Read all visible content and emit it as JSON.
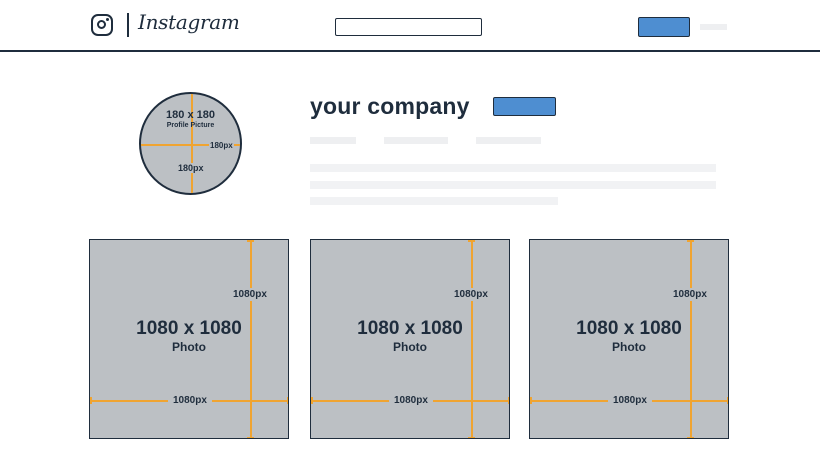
{
  "header": {
    "logo_icon": "instagram-camera-icon",
    "wordmark": "Instagram",
    "search": {
      "value": "",
      "placeholder": ""
    }
  },
  "profile": {
    "avatar": {
      "dimension": "180 x 180",
      "caption": "Profile Picture",
      "width_label": "180px",
      "height_label": "180px"
    },
    "company_name": "your company"
  },
  "posts": [
    {
      "dimension": "1080 x 1080",
      "caption": "Photo",
      "height_label": "1080px",
      "width_label": "1080px"
    },
    {
      "dimension": "1080 x 1080",
      "caption": "Photo",
      "height_label": "1080px",
      "width_label": "1080px"
    },
    {
      "dimension": "1080 x 1080",
      "caption": "Photo",
      "height_label": "1080px",
      "width_label": "1080px"
    }
  ],
  "colors": {
    "navy": "#1f2d3d",
    "button_blue": "#4e8ed1",
    "placeholder_gray": "#bcc0c4",
    "guide_orange": "#f0a431",
    "skeleton": "#eeeff1"
  }
}
